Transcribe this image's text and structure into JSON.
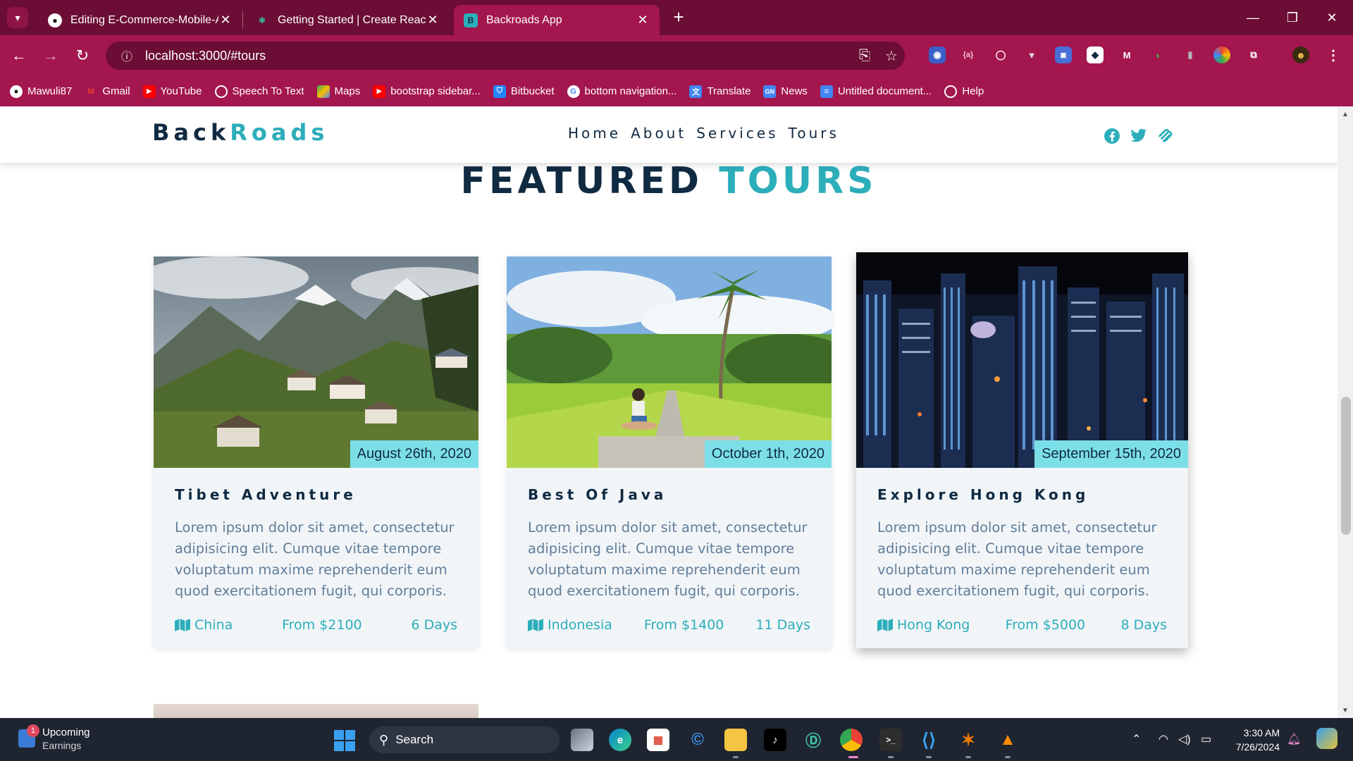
{
  "browser": {
    "tabs": [
      {
        "title": "Editing E-Commerce-Mobile-Ap",
        "favicon": "github-icon"
      },
      {
        "title": "Getting Started | Create React A",
        "favicon": "react-icon"
      },
      {
        "title": "Backroads App",
        "favicon": "b-icon",
        "active": true
      }
    ],
    "address": "localhost:3000/#tours",
    "bookmarks": [
      {
        "label": "Mawuli87",
        "icon": "github-icon"
      },
      {
        "label": "Gmail",
        "icon": "gmail-icon"
      },
      {
        "label": "YouTube",
        "icon": "youtube-icon"
      },
      {
        "label": "Speech To Text",
        "icon": "globe-icon"
      },
      {
        "label": "Maps",
        "icon": "maps-icon"
      },
      {
        "label": "bootstrap sidebar...",
        "icon": "youtube-icon"
      },
      {
        "label": "Bitbucket",
        "icon": "bitbucket-icon"
      },
      {
        "label": "bottom navigation...",
        "icon": "google-icon"
      },
      {
        "label": "Translate",
        "icon": "translate-icon"
      },
      {
        "label": "News",
        "icon": "news-icon"
      },
      {
        "label": "Untitled document...",
        "icon": "docs-icon"
      },
      {
        "label": "Help",
        "icon": "globe-icon"
      }
    ]
  },
  "site": {
    "logo": {
      "part1": "Back",
      "part2": "Roads"
    },
    "nav": [
      "Home",
      "About",
      "Services",
      "Tours"
    ],
    "title": {
      "part1": "FEATURED",
      "part2": "TOURS"
    },
    "accent_color": "#2caeba",
    "badge_color": "#7cdfe8",
    "tours": [
      {
        "date": "August 26th, 2020",
        "title": "Tibet Adventure",
        "text": "Lorem ipsum dolor sit amet, consectetur adipisicing elit. Cumque vitae tempore voluptatum maxime reprehenderit eum quod exercitationem fugit, qui corporis.",
        "location": "China",
        "price": "From $2100",
        "duration": "6 Days"
      },
      {
        "date": "October 1th, 2020",
        "title": "Best Of Java",
        "text": "Lorem ipsum dolor sit amet, consectetur adipisicing elit. Cumque vitae tempore voluptatum maxime reprehenderit eum quod exercitationem fugit, qui corporis.",
        "location": "Indonesia",
        "price": "From $1400",
        "duration": "11 Days"
      },
      {
        "date": "September 15th, 2020",
        "title": "Explore Hong Kong",
        "text": "Lorem ipsum dolor sit amet, consectetur adipisicing elit. Cumque vitae tempore voluptatum maxime reprehenderit eum quod exercitationem fugit, qui corporis.",
        "location": "Hong Kong",
        "price": "From $5000",
        "duration": "8 Days"
      }
    ]
  },
  "taskbar": {
    "weather": {
      "line1": "Upcoming",
      "line2": "Earnings",
      "badge": "1"
    },
    "search": "Search",
    "time": "3:30 AM",
    "date": "7/26/2024"
  }
}
